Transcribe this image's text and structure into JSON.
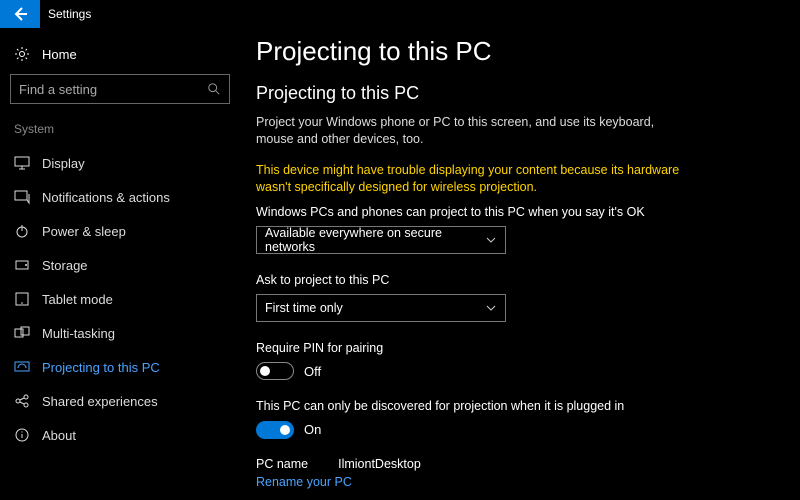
{
  "app": {
    "title": "Settings"
  },
  "home": {
    "label": "Home"
  },
  "search": {
    "placeholder": "Find a setting"
  },
  "sidebar": {
    "sectionLabel": "System",
    "items": [
      {
        "label": "Display"
      },
      {
        "label": "Notifications & actions"
      },
      {
        "label": "Power & sleep"
      },
      {
        "label": "Storage"
      },
      {
        "label": "Tablet mode"
      },
      {
        "label": "Multi-tasking"
      },
      {
        "label": "Projecting to this PC"
      },
      {
        "label": "Shared experiences"
      },
      {
        "label": "About"
      }
    ]
  },
  "page": {
    "title": "Projecting to this PC",
    "subtitle": "Projecting to this PC",
    "intro": "Project your Windows phone or PC to this screen, and use its keyboard, mouse and other devices, too.",
    "warning": "This device might have trouble displaying your content because its hardware wasn't specifically designed for wireless projection.",
    "setting1": {
      "label": "Windows PCs and phones can project to this PC when you say it's OK",
      "value": "Available everywhere on secure networks"
    },
    "setting2": {
      "label": "Ask to project to this PC",
      "value": "First time only"
    },
    "setting3": {
      "label": "Require PIN for pairing",
      "state": "Off"
    },
    "setting4": {
      "label": "This PC can only be discovered for projection when it is plugged in",
      "state": "On"
    },
    "pcname": {
      "label": "PC name",
      "value": "IlmiontDesktop"
    },
    "renameLink": "Rename your PC"
  }
}
